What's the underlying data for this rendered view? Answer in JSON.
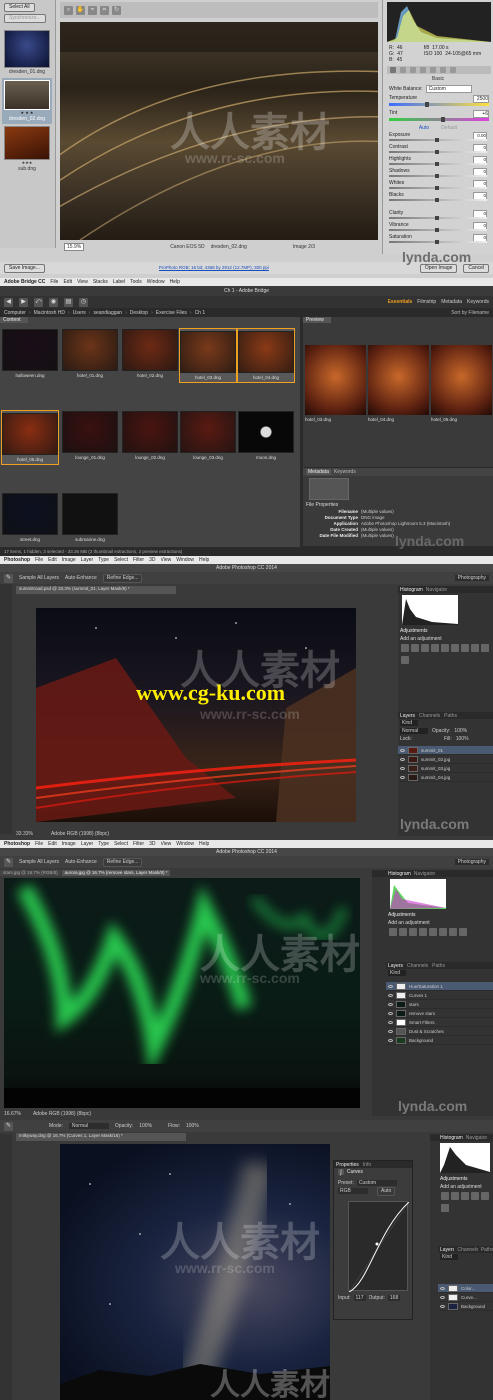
{
  "watermarks": {
    "site": "www.cg-ku.com",
    "cn": "人人素材",
    "rr": "www.rr-sc.com",
    "lynda": "lynda.com"
  },
  "p1": {
    "select_all": "Select All",
    "synchronize": "Synchronize...",
    "filmstrip": [
      {
        "name": "dresden_01.dng",
        "stars": ""
      },
      {
        "name": "dresden_02.dng",
        "stars": "★ ★ ★"
      },
      {
        "name": "sub.dng",
        "stars": "★★★"
      }
    ],
    "zoom": "15.9%",
    "camera": "Canon EOS 5D",
    "file": "dresden_02.dng",
    "image_count": "Image 2/3",
    "save_image": "Save Image...",
    "workflow": "ProPhoto RGB; 16 bit; 4368 by 2912 (12.7MP); 300 ppi",
    "open_image": "Open Image",
    "cancel": "Cancel",
    "readout": {
      "r": "R:",
      "g": "G:",
      "b": "B:",
      "rv": "46",
      "gv": "47",
      "bv": "45",
      "exif1": "f/8",
      "exif2": "17.00 s",
      "exif3": "ISO 100",
      "exif4": "24-105@65 mm"
    },
    "basic": "Basic",
    "wb_label": "White Balance:",
    "wb_value": "Custom",
    "temp_label": "Temperature",
    "temp_value": "2500",
    "tint_label": "Tint",
    "tint_value": "+6",
    "auto": "Auto",
    "default": "Default",
    "sliders": [
      {
        "label": "Exposure",
        "value": "0.00",
        "pos": 0.5
      },
      {
        "label": "Contrast",
        "value": "0",
        "pos": 0.5
      },
      {
        "label": "Highlights",
        "value": "0",
        "pos": 0.5
      },
      {
        "label": "Shadows",
        "value": "0",
        "pos": 0.5
      },
      {
        "label": "Whites",
        "value": "0",
        "pos": 0.5
      },
      {
        "label": "Blacks",
        "value": "0",
        "pos": 0.5
      },
      {
        "label": "Clarity",
        "value": "0",
        "pos": 0.5
      },
      {
        "label": "Vibrance",
        "value": "0",
        "pos": 0.5
      },
      {
        "label": "Saturation",
        "value": "0",
        "pos": 0.5
      }
    ]
  },
  "p2": {
    "menu": [
      "Adobe Bridge CC",
      "File",
      "Edit",
      "View",
      "Stacks",
      "Label",
      "Tools",
      "Window",
      "Help"
    ],
    "window_title": "Ch 1 - Adobe Bridge",
    "workspaces": [
      "Essentials",
      "Filmstrip",
      "Metadata",
      "Keywords"
    ],
    "sort": "Sort by Filename",
    "path": [
      "Computer",
      "Macintosh HD",
      "Users",
      "seandiaggan",
      "Desktop",
      "Exercise Files",
      "Ch 1"
    ],
    "content_tab": "Content",
    "preview_tab": "Preview",
    "thumbs": [
      {
        "name": "halloween.dng",
        "color": "#1a0d18",
        "sel": false
      },
      {
        "name": "hotel_01.dng",
        "color": "#6b3418",
        "sel": false
      },
      {
        "name": "hotel_02.dng",
        "color": "#6e2a14",
        "sel": false
      },
      {
        "name": "hotel_03.dng",
        "color": "#7a3a1a",
        "sel": true
      },
      {
        "name": "hotel_04.dng",
        "color": "#8a3a16",
        "sel": true
      },
      {
        "name": "hotel_05.dng",
        "color": "#8a2e12",
        "sel": true
      },
      {
        "name": "lounge_01.dng",
        "color": "#3a1010",
        "sel": false
      },
      {
        "name": "lounge_02.dng",
        "color": "#4a1410",
        "sel": false
      },
      {
        "name": "lounge_03.dng",
        "color": "#5a1a12",
        "sel": false
      },
      {
        "name": "moon.dng",
        "color": "#080808",
        "sel": false
      },
      {
        "name": "street.dng",
        "color": "#0c1020",
        "sel": false
      },
      {
        "name": "submarine.dng",
        "color": "#111",
        "sel": false
      }
    ],
    "preview_labels": [
      "hotel_03.dng",
      "hotel_04.dng",
      "hotel_05.dng"
    ],
    "metadata_tab": "Metadata",
    "keywords_tab": "Keywords",
    "file_props": "File Properties",
    "meta": [
      {
        "k": "Filename",
        "v": "(Multiple values)"
      },
      {
        "k": "Document Type",
        "v": "DNG image"
      },
      {
        "k": "Application",
        "v": "Adobe Photoshop Lightroom 5.3 (Macintosh)"
      },
      {
        "k": "Date Created",
        "v": "(Multiple values)"
      },
      {
        "k": "Date File Modified",
        "v": "(Multiple values)"
      }
    ],
    "status": "17 items, 1 hidden, 3 selected - 33.36 MB (3 thumbnail extractions, 2 preview extractions)"
  },
  "p3": {
    "menu": [
      "Photoshop",
      "File",
      "Edit",
      "Image",
      "Layer",
      "Type",
      "Select",
      "Filter",
      "3D",
      "View",
      "Window",
      "Help"
    ],
    "title": "Adobe Photoshop CC 2014",
    "workspace": "Photography",
    "opt": [
      "Sample All Layers",
      "Auto-Enhance",
      "Refine Edge..."
    ],
    "tab": "summitroad.psd @ 33.3% (summit_01, Layer Mask/8) *",
    "zoom": "33.33%",
    "profile": "Adobe RGB (1998) (8bpc)",
    "histogram": "Histogram",
    "navigator": "Navigator",
    "adjustments": "Adjustments",
    "add_adj": "Add an adjustment",
    "layers_tabs": [
      "Layers",
      "Channels",
      "Paths"
    ],
    "kind": "Kind",
    "normal": "Normal",
    "opacity": "Opacity:",
    "opacity_v": "100%",
    "lock": "Lock:",
    "fill": "Fill:",
    "fill_v": "100%",
    "layers": [
      "summit_01",
      "summit_02.jpg",
      "summit_03.jpg",
      "summit_04.jpg"
    ]
  },
  "p4": {
    "menu": [
      "Photoshop",
      "File",
      "Edit",
      "Image",
      "Layer",
      "Type",
      "Select",
      "Filter",
      "3D",
      "View",
      "Window",
      "Help"
    ],
    "title": "Adobe Photoshop CC 2014",
    "workspace": "Photography",
    "opt": [
      "Sample All Layers",
      "Auto-Enhance",
      "Refine Edge..."
    ],
    "tab1": "stars.jpg @ 16.7% (RGB/8)",
    "tab2": "aurora.jpg @ 16.7% (remove stars, Layer Mask/8) *",
    "zoom": "16.67%",
    "profile": "Adobe RGB (1998) (8bpc)",
    "histogram": "Histogram",
    "navigator": "Navigator",
    "adjustments": "Adjustments",
    "add_adj": "Add an adjustment",
    "layers_tabs": [
      "Layers",
      "Channels",
      "Paths"
    ],
    "kind": "Kind",
    "layers": [
      "Hue/Saturation 1",
      "Curves 1",
      "stars",
      "remove stars",
      "Smart Filters",
      "Dust & Scratches",
      "Background"
    ]
  },
  "p5": {
    "mode_label": "Mode:",
    "mode": "Normal",
    "opacity_label": "Opacity:",
    "opacity": "100%",
    "flow_label": "Flow:",
    "flow": "100%",
    "tab": "milkyway.dng @ 16.7% (Curves 1, Layer Mask/16) *",
    "props_tabs": [
      "Properties",
      "Info"
    ],
    "curves": "Curves",
    "preset_label": "Preset:",
    "preset": "Custom",
    "channel": "RGB",
    "auto": "Auto",
    "input_label": "Input:",
    "input": "117",
    "output_label": "Output:",
    "output": "168",
    "histogram": "Histogram",
    "navigator": "Navigator",
    "adjustments": "Adjustments",
    "add_adj": "Add an adjustment",
    "layers_tabs": [
      "Layers",
      "Channels",
      "Paths"
    ],
    "kind": "Kind",
    "layers": [
      "Color...",
      "Curve...",
      "Background"
    ]
  }
}
